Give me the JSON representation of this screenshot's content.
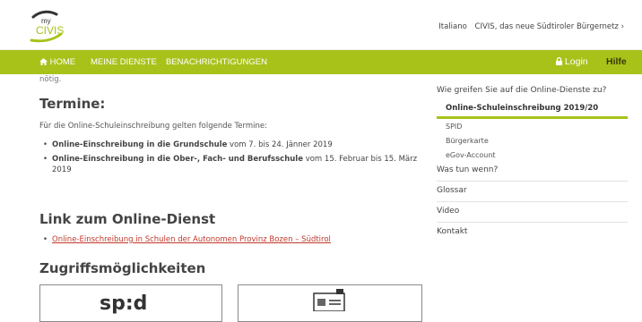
{
  "header": {
    "logo_text_small": "my",
    "logo_text": "CIVIS",
    "links": [
      "Italiano",
      "CIVIS, das neue Südtiroler Bürgernetz ›"
    ]
  },
  "nav": {
    "home": "HOME",
    "dienste": "MEINE DIENSTE",
    "benachrichtigungen": "BENACHRICHTIGUNGEN",
    "login": "Login",
    "hilfe": "Hilfe"
  },
  "main": {
    "fragment": "nötig.",
    "termine_title": "Termine:",
    "termine_intro": "Für die Online-Schuleinschreibung gelten folgende Termine:",
    "termine_items": [
      {
        "bold": "Online-Einschreibung in die Grundschule",
        "rest": " vom 7. bis 24. Jänner 2019"
      },
      {
        "bold": "Online-Einschreibung in die Ober-, Fach- und Berufsschule",
        "rest": " vom 15. Februar bis 15. März 2019"
      }
    ],
    "link_title": "Link zum Online-Dienst",
    "link_text": "Online-Einschreibung in Schulen der Autonomen Provinz Bozen – Südtirol",
    "zugriff_title": "Zugriffsmöglichkeiten",
    "card1_text": "sp:d"
  },
  "sidebar": {
    "top_question": "Wie greifen Sie auf die Online-Dienste zu?",
    "active": "Online-Schuleinschreibung 2019/20",
    "sub_items": [
      "SPID",
      "Bürgerkarte",
      "eGov-Account"
    ],
    "items": [
      "Was tun wenn?",
      "Glossar",
      "Video",
      "Kontakt"
    ]
  },
  "colors": {
    "accent": "#a9c21a",
    "link": "#c0392b"
  }
}
